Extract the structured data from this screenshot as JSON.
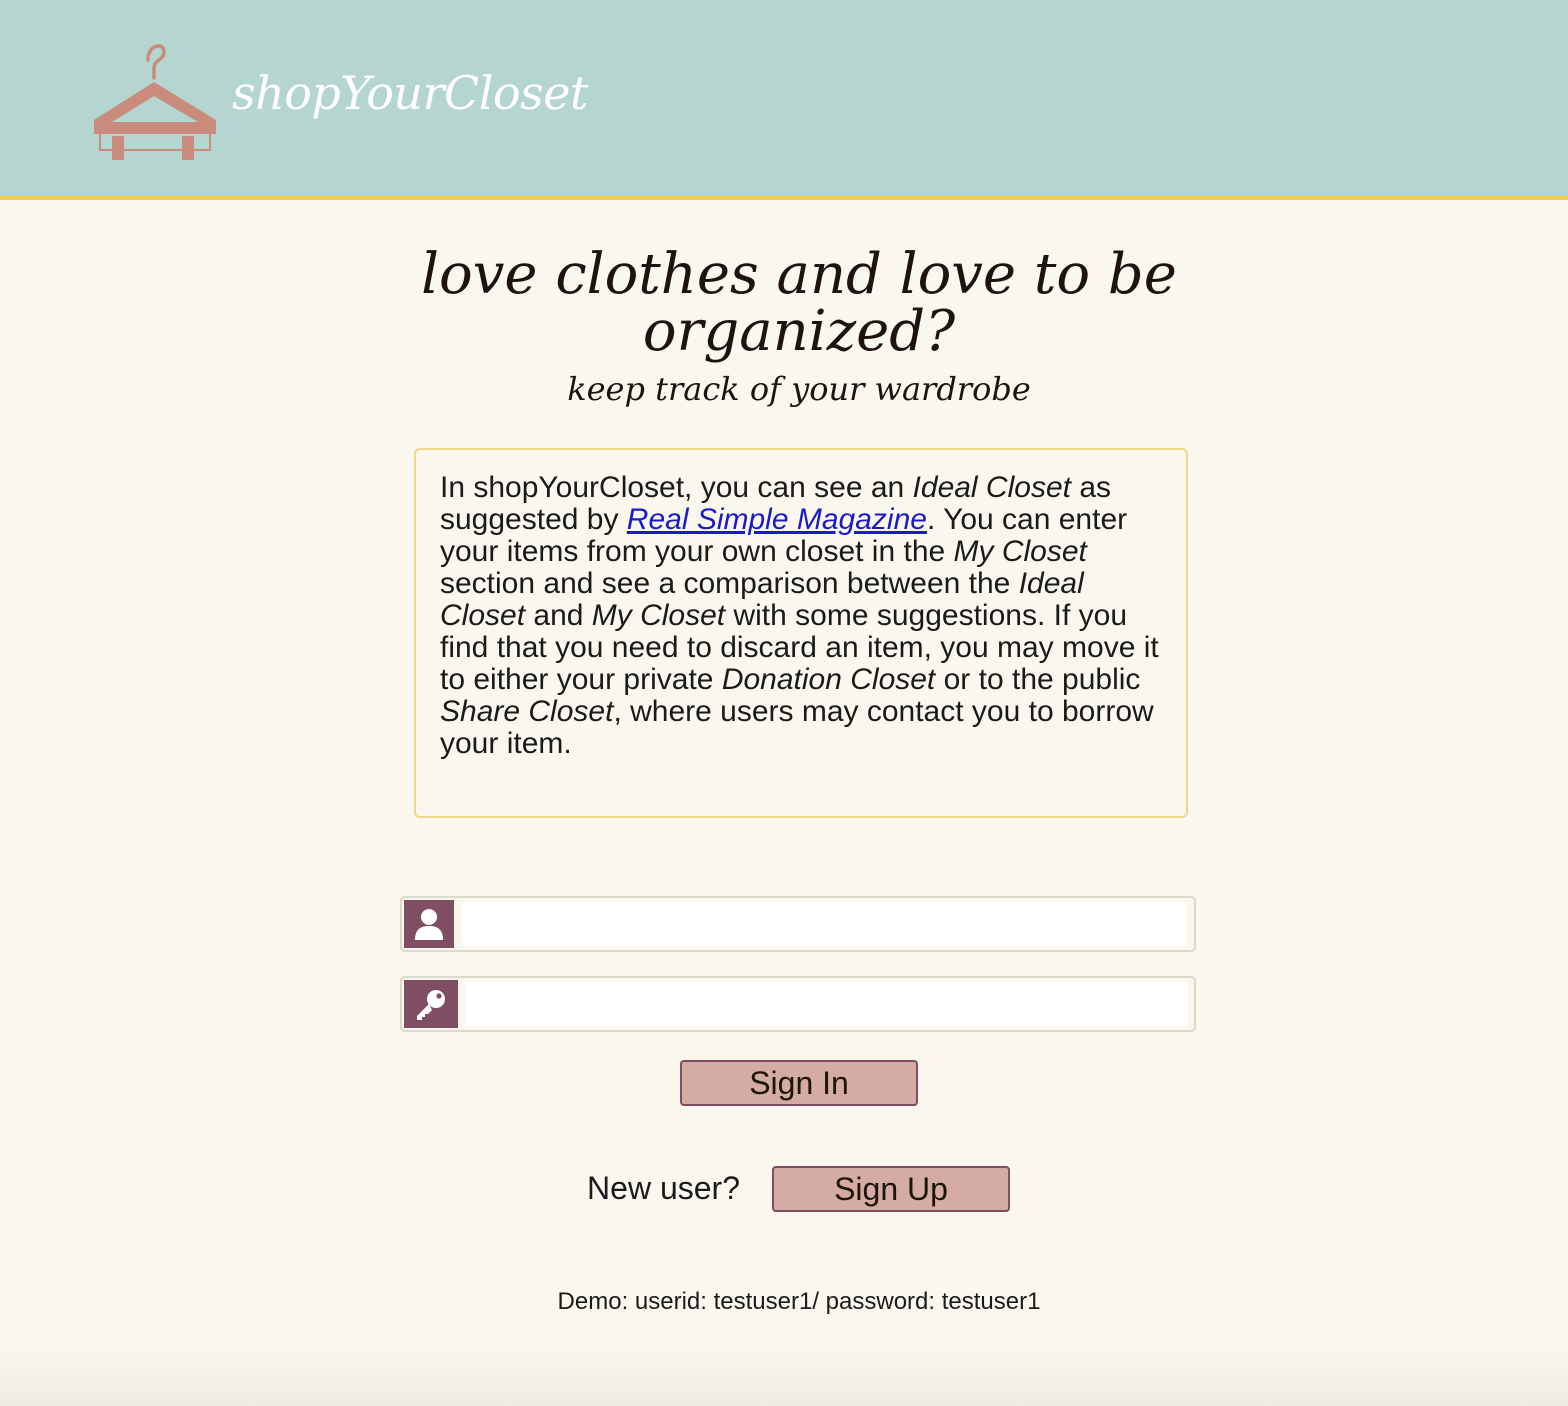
{
  "header": {
    "brand": "shopYourCloset",
    "logo_icon": "hanger-icon",
    "background_color": "#b4d5d0",
    "accent_color": "#f2cf4a"
  },
  "hero": {
    "title": "love clothes and love to be organized?",
    "subtitle": "keep track of your wardrobe"
  },
  "description": {
    "p1": "In shopYourCloset, you can see an ",
    "ideal_closet_1": "Ideal Closet",
    "p2": " as suggested by ",
    "link_text": "Real Simple Magazine",
    "p3": ". You can enter your items from your own closet in the ",
    "my_closet_1": "My Closet",
    "p4": " section and see a comparison between the ",
    "ideal_closet_2": "Ideal Closet",
    "p5": " and ",
    "my_closet_2": "My Closet",
    "p6": " with some suggestions. If you find that you need to discard an item, you may move it to either your private ",
    "donation_closet": "Donation Closet",
    "p7": " or to the public ",
    "share_closet": "Share Closet",
    "p8": ", where users may contact you to borrow your item."
  },
  "login": {
    "user_icon": "user-icon",
    "user_value": "",
    "password_icon": "key-icon",
    "password_value": "",
    "signin_label": "Sign In",
    "new_user_label": "New user?",
    "signup_label": "Sign Up",
    "button_color": "#d4aca4",
    "icon_box_color": "#7f4e63"
  },
  "demo_text": "Demo: userid: testuser1/ password: testuser1"
}
